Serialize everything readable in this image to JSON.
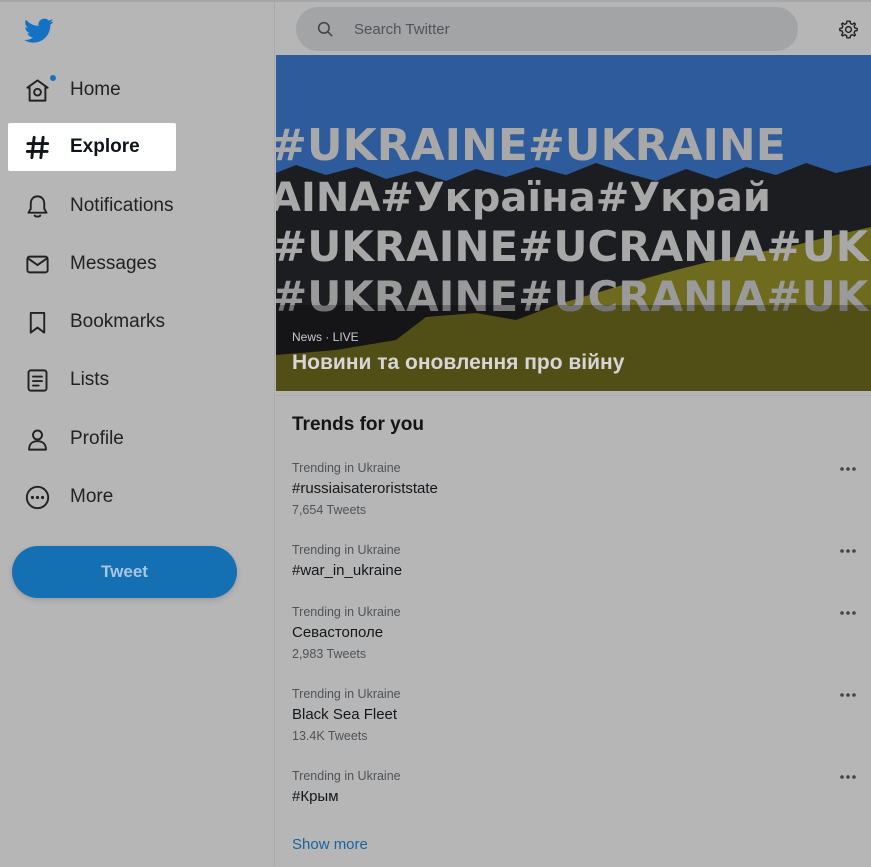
{
  "sidebar": {
    "items": [
      {
        "label": "Home",
        "icon": "home-icon",
        "has_dot": true
      },
      {
        "label": "Explore",
        "icon": "hashtag-icon",
        "active": true
      },
      {
        "label": "Notifications",
        "icon": "bell-icon"
      },
      {
        "label": "Messages",
        "icon": "mail-icon"
      },
      {
        "label": "Bookmarks",
        "icon": "bookmark-icon"
      },
      {
        "label": "Lists",
        "icon": "list-icon"
      },
      {
        "label": "Profile",
        "icon": "person-icon"
      },
      {
        "label": "More",
        "icon": "more-circle-icon"
      }
    ],
    "tweet_label": "Tweet"
  },
  "search": {
    "placeholder": "Search Twitter"
  },
  "hero": {
    "lines": [
      "#UKRAINE#UKRAINE",
      "AINA#Україна#Украй",
      "#UKRAINE#UCRANIA#UKRAI",
      "#UKRAINE#UCRANIA#UK"
    ],
    "category": "News · LIVE",
    "title": "Новини та оновлення про війну"
  },
  "trends": {
    "title": "Trends for you",
    "items": [
      {
        "context": "Trending in Ukraine",
        "name": "#russiaisateroriststate",
        "count": "7,654 Tweets"
      },
      {
        "context": "Trending in Ukraine",
        "name": "#war_in_ukraine",
        "count": ""
      },
      {
        "context": "Trending in Ukraine",
        "name": "Севастополе",
        "count": "2,983 Tweets"
      },
      {
        "context": "Trending in Ukraine",
        "name": "Black Sea Fleet",
        "count": "13.4K Tweets"
      },
      {
        "context": "Trending in Ukraine",
        "name": "#Крым",
        "count": ""
      }
    ],
    "show_more": "Show more"
  },
  "colors": {
    "accent": "#146fb3",
    "link": "#1b62a0",
    "background": "#b6b6b6",
    "flag_blue": "#2d5b9c",
    "flag_yellow": "#6e6a1e"
  }
}
